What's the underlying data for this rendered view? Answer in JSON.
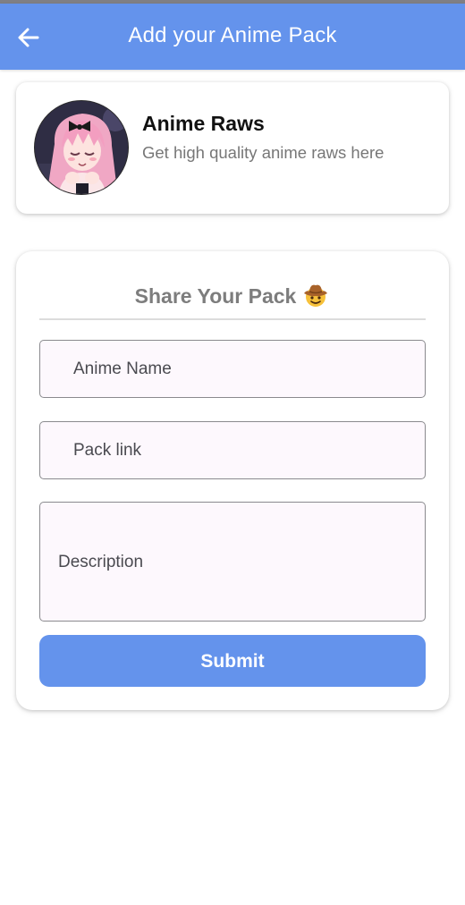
{
  "appbar": {
    "title": "Add your Anime Pack",
    "back_icon": "arrow-left-icon"
  },
  "profile": {
    "name": "Anime Raws",
    "subtitle": "Get high quality anime raws here",
    "avatar": "anime-girl-avatar"
  },
  "form": {
    "title": "Share Your Pack",
    "title_emoji": "cowboy-hat-face-emoji",
    "fields": {
      "anime_name": {
        "placeholder": "Anime Name",
        "value": ""
      },
      "pack_link": {
        "placeholder": "Pack link",
        "value": ""
      },
      "description": {
        "placeholder": "Description",
        "value": ""
      }
    },
    "submit_label": "Submit"
  },
  "colors": {
    "primary": "#6493ec",
    "field_background": "#fdf8fd",
    "field_border": "#8a8a8e",
    "title_gray": "#7d7d7d"
  }
}
